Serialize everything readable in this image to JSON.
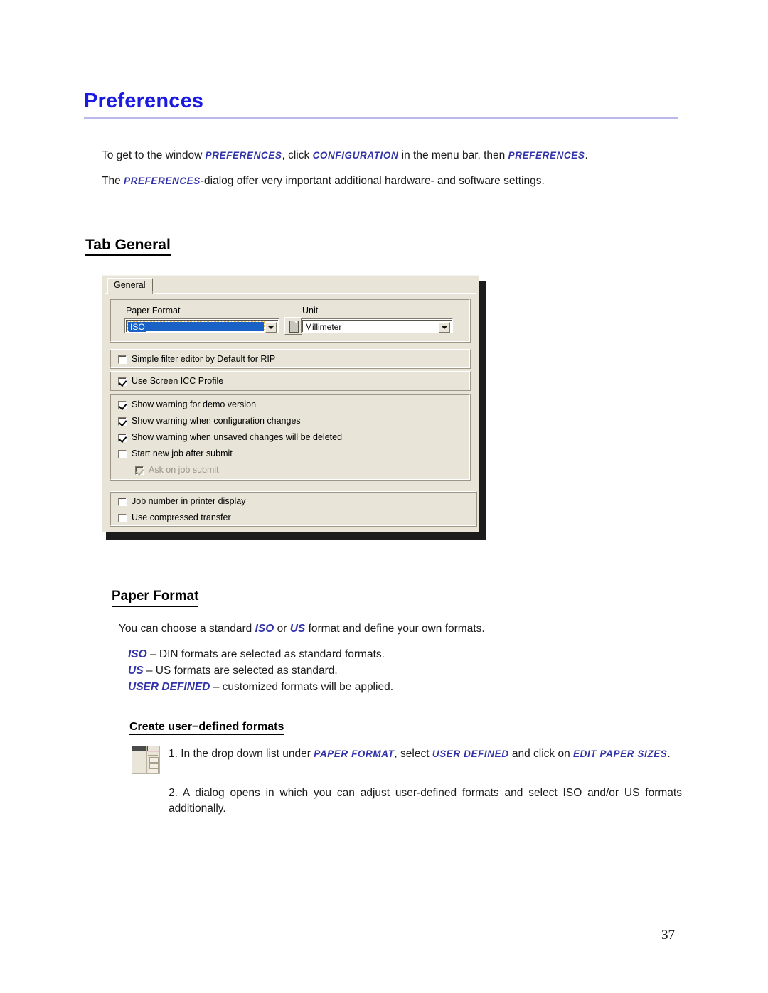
{
  "document": {
    "title": "Preferences",
    "page_number": "37",
    "intro": {
      "line1_part1": "To get to the window ",
      "line1_sc1": "PREFERENCES",
      "line1_part2": ", click ",
      "line1_sc2": "CONFIGURATION",
      "line1_part3": " in the menu bar, then ",
      "line1_sc3": "PREFERENCES",
      "line1_part4": ".",
      "line2_part1": "The ",
      "line2_sc1": "PREFERENCES",
      "line2_part2": "-dialog offer very important additional hardware- and software settings."
    },
    "section_tab_general": {
      "heading": "Tab General"
    },
    "section_paper_format": {
      "heading": "Paper Format",
      "para_part1": "You can choose a standard ",
      "para_iso": "ISO",
      "para_or": " or ",
      "para_us": "US",
      "para_part2": " format and define your own formats.",
      "definitions": [
        {
          "term": "ISO",
          "desc": " – DIN formats are selected as standard formats."
        },
        {
          "term": "US",
          "desc": " – US formats are selected as standard."
        },
        {
          "term": "USER DEFINED",
          "desc": " – customized formats will be applied."
        }
      ],
      "create_heading": "Create user−defined formats",
      "step1": {
        "part1": "1. In the drop down list under ",
        "sc1": "PAPER FORMAT",
        "part2": ", select ",
        "sc2": "USER DEFINED",
        "part3": " and click on ",
        "sc3": "EDIT PAPER SIZES",
        "part4": "."
      },
      "step2": "2. A dialog opens in which you can adjust user-defined formats and select ISO and/or US formats additionally."
    }
  },
  "dialog": {
    "tab_label": "General",
    "paper_format": {
      "label": "Paper Format",
      "value": "ISO",
      "button_icon": "document-icon"
    },
    "unit": {
      "label": "Unit",
      "value": "Millimeter"
    },
    "options": {
      "filter": {
        "label": "Simple filter editor by Default for RIP",
        "checked": false
      },
      "icc": {
        "label": "Use Screen ICC Profile",
        "checked": true
      },
      "warnings": [
        {
          "label": "Show warning for demo version",
          "checked": true
        },
        {
          "label": "Show warning when configuration changes",
          "checked": true
        },
        {
          "label": "Show warning when unsaved changes will be deleted",
          "checked": true
        },
        {
          "label": "Start new job after submit",
          "checked": false
        },
        {
          "label": "Ask on job submit",
          "checked": true,
          "disabled": true
        }
      ],
      "misc": [
        {
          "label": "Job number in printer display",
          "checked": false
        },
        {
          "label": "Use compressed transfer",
          "checked": false
        }
      ]
    }
  },
  "colors": {
    "heading_blue": "#1a1ae0",
    "smallcaps_blue": "#3333aa",
    "dialog_face": "#e8e4d7",
    "selection_blue": "#1961c4"
  }
}
